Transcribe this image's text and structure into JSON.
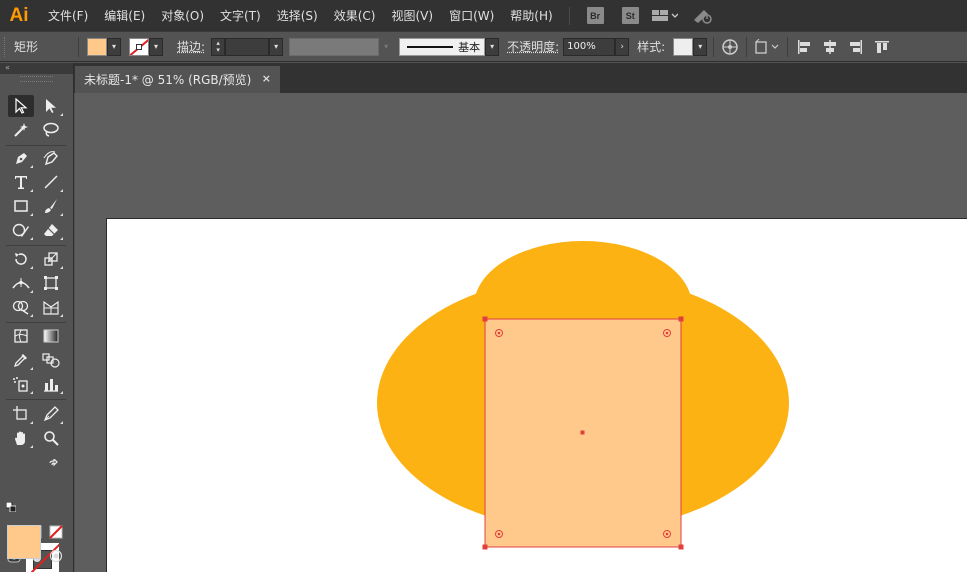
{
  "app": {
    "logo": "Ai"
  },
  "menu": [
    "文件(F)",
    "编辑(E)",
    "对象(O)",
    "文字(T)",
    "选择(S)",
    "效果(C)",
    "视图(V)",
    "窗口(W)",
    "帮助(H)"
  ],
  "menubar_badges": {
    "bridge": "Br",
    "stock": "St"
  },
  "controlbar": {
    "object_type": "矩形",
    "stroke_label": "描边",
    "stroke_colon": ":",
    "stroke_profile": "基本",
    "opacity_label": "不透明度",
    "opacity_colon": ":",
    "opacity_value": "100%",
    "style_label": "样式",
    "style_colon": ":"
  },
  "document_tab": {
    "title": "未标题-1* @ 51% (RGB/预览)",
    "close": "×"
  },
  "toolpanel": {
    "collapse": "«"
  },
  "colors": {
    "fill": "#ffc98c",
    "ellipse": "#fdb213",
    "selection": "#e0403c",
    "artboard": "#ffffff",
    "pasteboard": "#5e5e5e",
    "panel": "#535353",
    "menubar": "#323232"
  }
}
